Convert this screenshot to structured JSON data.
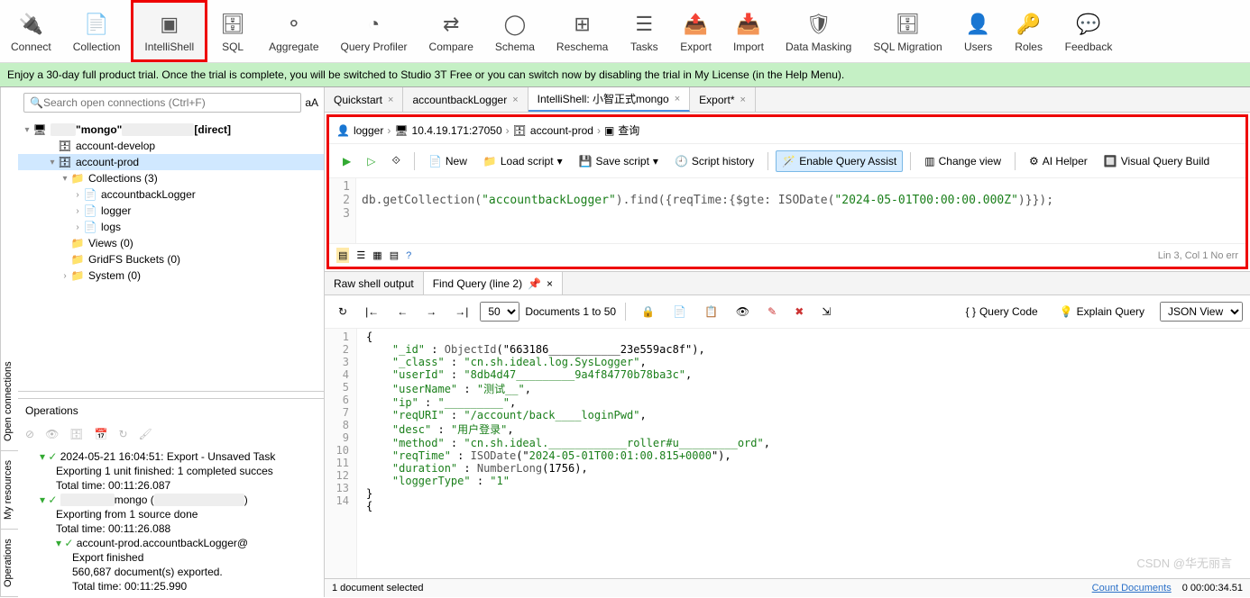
{
  "toolbar": [
    {
      "label": "Connect",
      "icon": "connect"
    },
    {
      "label": "Collection",
      "icon": "doc"
    },
    {
      "label": "IntelliShell",
      "icon": "shell",
      "highlight": true
    },
    {
      "label": "SQL",
      "icon": "sql"
    },
    {
      "label": "Aggregate",
      "icon": "aggregate"
    },
    {
      "label": "Query Profiler",
      "icon": "profiler"
    },
    {
      "label": "Compare",
      "icon": "compare"
    },
    {
      "label": "Schema",
      "icon": "schema"
    },
    {
      "label": "Reschema",
      "icon": "reschema"
    },
    {
      "label": "Tasks",
      "icon": "tasks"
    },
    {
      "label": "Export",
      "icon": "export"
    },
    {
      "label": "Import",
      "icon": "import"
    },
    {
      "label": "Data Masking",
      "icon": "mask"
    },
    {
      "label": "SQL Migration",
      "icon": "migration"
    },
    {
      "label": "Users",
      "icon": "users"
    },
    {
      "label": "Roles",
      "icon": "roles"
    },
    {
      "label": "Feedback",
      "icon": "feedback"
    }
  ],
  "trial_text": "Enjoy a 30-day full product trial. Once the trial is complete, you will be switched to Studio 3T Free or you can switch now by disabling the trial in My License (in the Help Menu).",
  "side_tabs": {
    "top": "Open connections",
    "mid": "My resources",
    "bottom": "Operations"
  },
  "search_placeholder": "Search open connections (Ctrl+F)",
  "tree": {
    "root": "\"mongo\"",
    "root_suffix": "[direct]",
    "items": [
      {
        "indent": 2,
        "tw": "",
        "icon": "🗄",
        "label": "account-develop"
      },
      {
        "indent": 2,
        "tw": "▾",
        "icon": "🗄",
        "label": "account-prod",
        "selected": true
      },
      {
        "indent": 3,
        "tw": "▾",
        "icon": "📁",
        "label": "Collections (3)"
      },
      {
        "indent": 4,
        "tw": "›",
        "icon": "📄",
        "label": "accountbackLogger"
      },
      {
        "indent": 4,
        "tw": "›",
        "icon": "📄",
        "label": "logger"
      },
      {
        "indent": 4,
        "tw": "›",
        "icon": "📄",
        "label": "logs"
      },
      {
        "indent": 3,
        "tw": "",
        "icon": "📁",
        "label": "Views (0)"
      },
      {
        "indent": 3,
        "tw": "",
        "icon": "📁",
        "label": "GridFS Buckets (0)"
      },
      {
        "indent": 3,
        "tw": "›",
        "icon": "📁",
        "label": "System (0)"
      }
    ]
  },
  "ops_header": "Operations",
  "ops": [
    {
      "indent": 0,
      "check": true,
      "label": "2024-05-21 16:04:51:  Export - Unsaved Task"
    },
    {
      "indent": 1,
      "label": "Exporting 1 unit finished: 1 completed succes"
    },
    {
      "indent": 1,
      "label": "Total time: 00:11:26.087"
    },
    {
      "indent": 0,
      "check": true,
      "redact": true
    },
    {
      "indent": 1,
      "label": "Exporting from 1 source done"
    },
    {
      "indent": 1,
      "label": "Total time: 00:11:26.088"
    },
    {
      "indent": 1,
      "check": true,
      "label": "account-prod.accountbackLogger@"
    },
    {
      "indent": 2,
      "label": "Export finished"
    },
    {
      "indent": 2,
      "label": "560,687 document(s) exported."
    },
    {
      "indent": 2,
      "label": "Total time: 00:11:25.990"
    }
  ],
  "editor_tabs": [
    {
      "label": "Quickstart",
      "close": true
    },
    {
      "label": "accountbackLogger",
      "close": true
    },
    {
      "label": "IntelliShell: 小智正式mongo",
      "close": true,
      "active": true
    },
    {
      "label": "Export*",
      "close": true
    }
  ],
  "breadcrumb": [
    {
      "icon": "👤",
      "label": "logger"
    },
    {
      "icon": "🖥",
      "label": "10.4.19.171:27050"
    },
    {
      "icon": "🗄",
      "label": "account-prod"
    },
    {
      "icon": "▣",
      "label": "查询"
    }
  ],
  "editor_buttons": {
    "new": "New",
    "load": "Load script",
    "save": "Save script",
    "history": "Script history",
    "assist": "Enable Query Assist",
    "change": "Change view",
    "ai": "AI Helper",
    "vqb": "Visual Query Build"
  },
  "code_lines": [
    "1",
    "2",
    "3"
  ],
  "code_content": {
    "prefix": "db.getCollection(",
    "col": "\"accountbackLogger\"",
    "mid": ").find({reqTime:{$gte: ISODate(",
    "date": "\"2024-05-01T00:00:00.000Z\"",
    "suffix": ")}});"
  },
  "code_status": "Lin 3, Col 1  No err",
  "result_tabs": [
    {
      "label": "Raw shell output"
    },
    {
      "label": "Find Query (line 2)",
      "pin": true,
      "close": true,
      "active": true
    }
  ],
  "result_toolbar": {
    "page_size": "50",
    "docs": "Documents 1 to 50",
    "qcode": "Query Code",
    "explain": "Explain Query",
    "view": "JSON View"
  },
  "json_lines": [
    "1",
    "2",
    "3",
    "4",
    "5",
    "6",
    "7",
    "8",
    "9",
    "10",
    "11",
    "12",
    "13",
    "14"
  ],
  "json": [
    "{",
    "    \"_id\" : ObjectId(\"663186___________23e559ac8f\"),",
    "    \"_class\" : \"cn.sh.ideal.log.SysLogger\",",
    "    \"userId\" : \"8db4d47_________9a4f84770b78ba3c\",",
    "    \"userName\" : \"测试__\",",
    "    \"ip\" : \"_________\",",
    "    \"reqURI\" : \"/account/back____loginPwd\",",
    "    \"desc\" : \"用户登录\",",
    "    \"method\" : \"cn.sh.ideal.____________roller#u_________ord\",",
    "    \"reqTime\" : ISODate(\"2024-05-01T00:01:00.815+0000\"),",
    "    \"duration\" : NumberLong(1756),",
    "    \"loggerType\" : \"1\"",
    "}",
    "{"
  ],
  "status": {
    "selected": "1 document selected",
    "count": "Count Documents",
    "time": "0 00:00:34.51"
  },
  "watermark": "CSDN @华无丽言"
}
